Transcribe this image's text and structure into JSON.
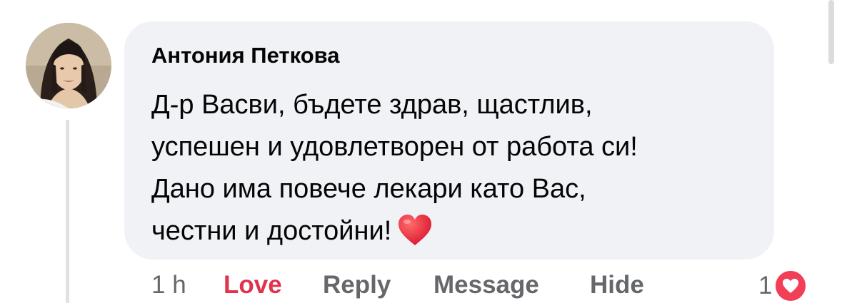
{
  "comment": {
    "author": "Антония Петкова",
    "text_lines": [
      "Д-р Васви, бъдете здрав, щастлив,",
      "успешен и удовлетворен от работа си!",
      "Дано има повече лекари като Вас,",
      "честни и достойни!"
    ],
    "emoji": "red-heart",
    "timestamp": "1 h",
    "actions": {
      "love": "Love",
      "reply": "Reply",
      "message": "Message",
      "hide": "Hide"
    },
    "reaction_count": "1",
    "reaction_type": "love"
  },
  "colors": {
    "bubble": "#f0f2f5",
    "love_active": "#e0334d",
    "action_text": "#65676b",
    "love_badge": "#f33e58",
    "text": "#050505"
  }
}
